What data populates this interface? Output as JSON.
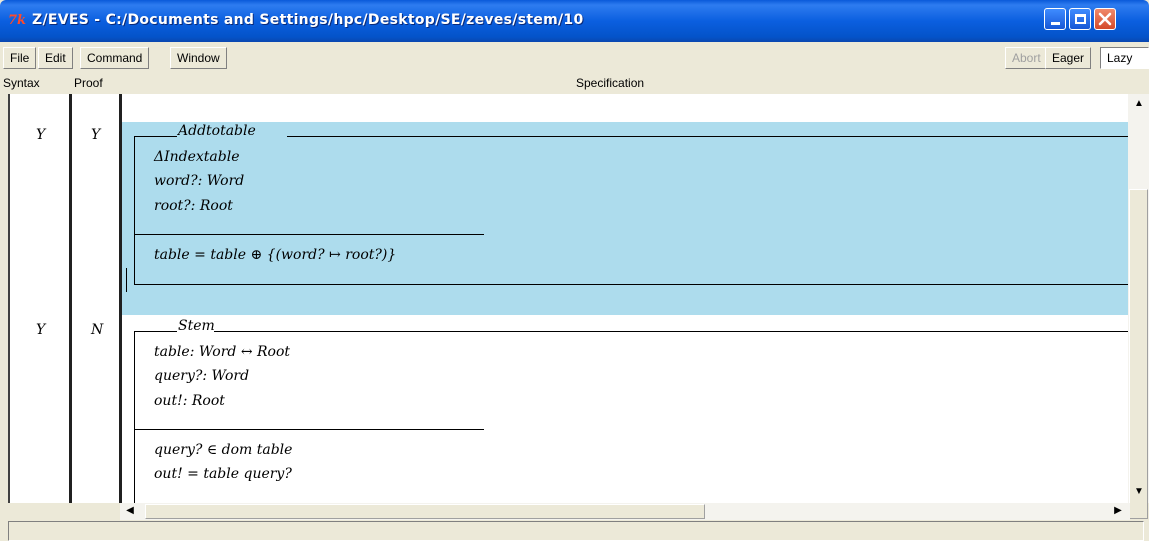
{
  "window": {
    "icon_text": "7k",
    "title": "Z/EVES - C:/Documents and Settings/hpc/Desktop/SE/zeves/stem/10"
  },
  "menu": {
    "file": "File",
    "edit": "Edit",
    "command": "Command",
    "window": "Window",
    "abort": "Abort",
    "eager": "Eager",
    "lazy": "Lazy"
  },
  "columns": {
    "syntax": "Syntax",
    "proof": "Proof",
    "spec": "Specification"
  },
  "paragraphs": [
    {
      "syntax": "Y",
      "proof": "Y",
      "schema_name": "Addtotable",
      "declarations": [
        "ΔIndextable",
        "word?: Word",
        "root?: Root"
      ],
      "predicates": [
        "table = table ⊕ {(word? ↦ root?)}"
      ],
      "highlighted": true
    },
    {
      "syntax": "Y",
      "proof": "N",
      "schema_name": "Stem",
      "declarations": [
        "table: Word ↔ Root",
        "query?: Word",
        "out!: Root"
      ],
      "predicates": [
        "query? ∈ dom table",
        "out! = table query?"
      ],
      "highlighted": false
    }
  ],
  "colors": {
    "title_bar": "#0b5fe0",
    "highlight": "#addced",
    "close_button": "#d44a2a"
  }
}
